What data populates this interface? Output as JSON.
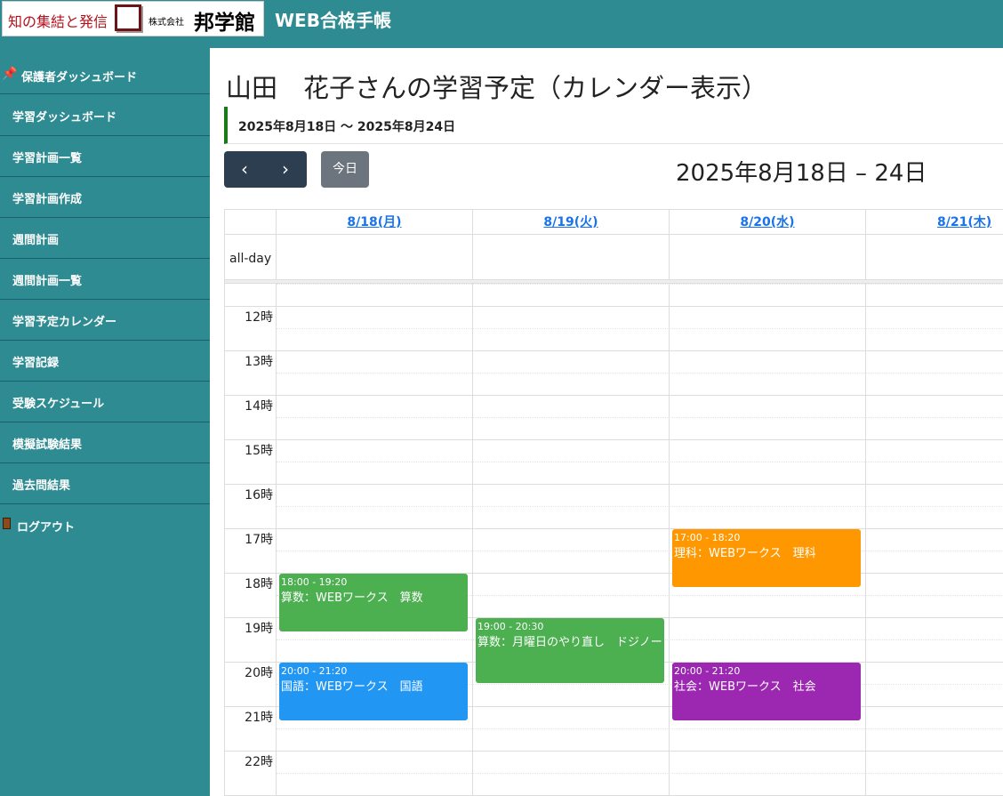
{
  "header": {
    "logo_slogan": "知の集結と発信",
    "logo_company_prefix": "株式会社",
    "logo_company_name": "邦学館",
    "app_title": "WEB合格手帳"
  },
  "sidebar": {
    "dashboard_label": "保護者ダッシュボード",
    "items": [
      {
        "label": "学習ダッシュボード"
      },
      {
        "label": "学習計画一覧"
      },
      {
        "label": "学習計画作成"
      },
      {
        "label": "週間計画"
      },
      {
        "label": "週間計画一覧"
      },
      {
        "label": "学習予定カレンダー"
      },
      {
        "label": "学習記録"
      },
      {
        "label": "受験スケジュール"
      },
      {
        "label": "模擬試験結果"
      },
      {
        "label": "過去問結果"
      }
    ],
    "logout_label": "ログアウト"
  },
  "main": {
    "page_title": "山田　花子さんの学習予定（カレンダー表示）",
    "date_range": "2025年8月18日 〜 2025年8月24日",
    "prev_label": "‹",
    "next_label": "›",
    "today_label": "今日",
    "calendar_title": "2025年8月18日 – 24日",
    "allday_label": "all-day",
    "days": [
      "8/18(月)",
      "8/19(火)",
      "8/20(水)",
      "8/21(木)"
    ],
    "hours": [
      "12時",
      "13時",
      "14時",
      "15時",
      "16時",
      "17時",
      "18時",
      "19時",
      "20時",
      "21時",
      "22時"
    ],
    "events": [
      {
        "day": 0,
        "time": "18:00 - 19:20",
        "title": "算数：WEBワークス　算数",
        "start": 18.0,
        "end": 19.333,
        "color": "#4caf50"
      },
      {
        "day": 0,
        "time": "20:00 - 21:20",
        "title": "国語：WEBワークス　国語",
        "start": 20.0,
        "end": 21.333,
        "color": "#2196f3"
      },
      {
        "day": 1,
        "time": "19:00 - 20:30",
        "title": "算数：月曜日のやり直し　ドジノート",
        "start": 19.0,
        "end": 20.5,
        "color": "#4caf50"
      },
      {
        "day": 2,
        "time": "17:00 - 18:20",
        "title": "理科：WEBワークス　理科",
        "start": 17.0,
        "end": 18.333,
        "color": "#ff9800"
      },
      {
        "day": 2,
        "time": "20:00 - 21:20",
        "title": "社会：WEBワークス　社会",
        "start": 20.0,
        "end": 21.333,
        "color": "#9c27b0"
      }
    ]
  },
  "colors": {
    "sidebar_bg": "#2e8b92",
    "nav_button": "#2c3e50",
    "today_button": "#6c757d",
    "accent_bar": "#1a7a1a",
    "day_link": "#1a73e8"
  }
}
